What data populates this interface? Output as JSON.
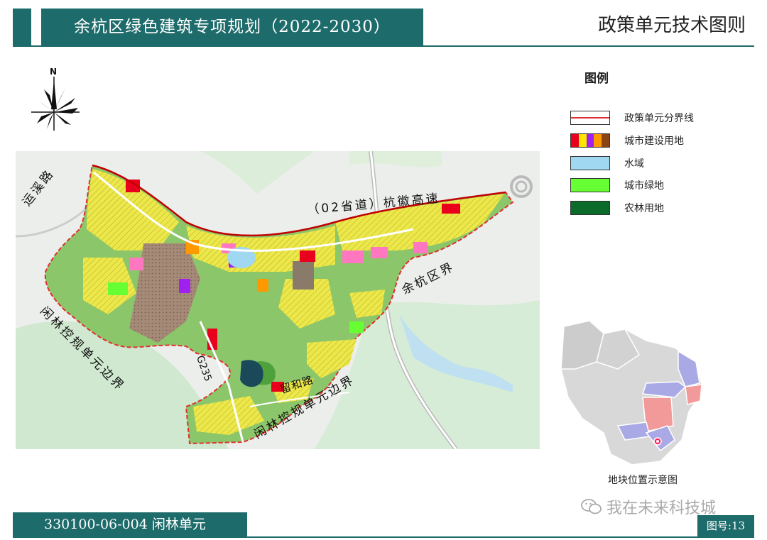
{
  "header": {
    "title": "余杭区绿色建筑专项规划（2022-2030）",
    "right_title": "政策单元技术图则"
  },
  "compass": {
    "north_label": "N"
  },
  "map_labels": {
    "road_left": "运溪路",
    "highway": "（02省道）杭徽高速",
    "boundary_east": "余杭区界",
    "boundary_sw": "闲林控规单元边界",
    "boundary_south": "闲林控规单元边界",
    "road_g235": "G235",
    "road_south": "留和路"
  },
  "legend": {
    "title": "图例",
    "items": [
      {
        "label": "政策单元分界线",
        "type": "boundary",
        "color": "#e03030"
      },
      {
        "label": "城市建设用地",
        "type": "multi",
        "colors": [
          "#e8001c",
          "#ffe600",
          "#a020f0",
          "#ff9900",
          "#8b4513"
        ]
      },
      {
        "label": "水域",
        "type": "solid",
        "color": "#9fd8f0"
      },
      {
        "label": "城市绿地",
        "type": "solid",
        "color": "#66ff33"
      },
      {
        "label": "农林用地",
        "type": "solid",
        "color": "#0a6b2a"
      }
    ]
  },
  "inset": {
    "caption": "地块位置示意图"
  },
  "watermark": {
    "text": "我在未来科技城"
  },
  "footer": {
    "unit_code": "330100-06-004 闲林单元",
    "figure_number": "图号:13"
  },
  "colors": {
    "brand": "#1d6b6a",
    "boundary": "#e03030",
    "green_land": "#7dbd5a",
    "construction": "#ede84a"
  }
}
